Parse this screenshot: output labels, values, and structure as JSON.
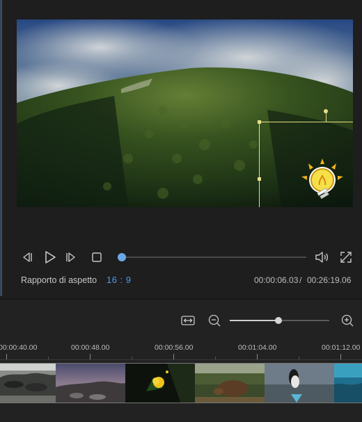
{
  "player": {
    "aspect_label": "Rapporto di aspetto",
    "aspect_value": "16 : 9",
    "time_current": "00:00:06.03",
    "time_separator": "/",
    "time_total": "00:26:19.06",
    "progress_fraction": 0.004,
    "icons": {
      "prev_frame": "prev-frame-icon",
      "play": "play-icon",
      "next_frame": "next-frame-icon",
      "stop": "stop-icon",
      "volume": "volume-icon",
      "fullscreen": "fullscreen-icon"
    }
  },
  "preview": {
    "sticker": "lightbulb-sticker",
    "accent_color": "#e8e08a"
  },
  "timeline": {
    "zoom_fraction": 0.49,
    "icons": {
      "fit": "fit-timeline-icon",
      "zoom_out": "zoom-out-icon",
      "zoom_in": "zoom-in-icon"
    },
    "ruler_labels": [
      "00:00:40.00",
      "00:00:48.00",
      "00:00:56.00",
      "00:01:04.00",
      "00:01:12.00"
    ],
    "clips": [
      {
        "name": "iguanas"
      },
      {
        "name": "dusk-landscape"
      },
      {
        "name": "yellow-flower"
      },
      {
        "name": "tortoise"
      },
      {
        "name": "booby-bird"
      },
      {
        "name": "underwater"
      }
    ]
  },
  "colors": {
    "accent": "#4c9be8",
    "background": "#1e1e1e"
  }
}
